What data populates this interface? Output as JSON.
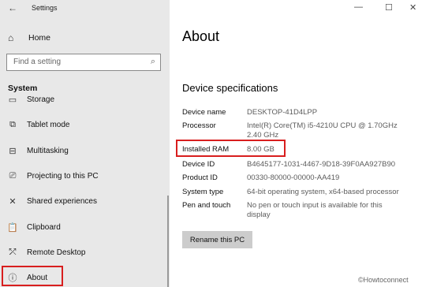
{
  "window": {
    "back_glyph": "←",
    "title": "Settings",
    "minimize_glyph": "—",
    "maximize_glyph": "☐",
    "close_glyph": "✕"
  },
  "sidebar": {
    "home_icon": "home-icon",
    "home_label": "Home",
    "search_placeholder": "Find a setting",
    "search_icon": "search-icon",
    "section_title": "System",
    "items": [
      {
        "label": "Storage",
        "icon": "storage-icon",
        "glyph": "▭"
      },
      {
        "label": "Tablet mode",
        "icon": "tablet-mode-icon",
        "glyph": "⧉"
      },
      {
        "label": "Multitasking",
        "icon": "multitasking-icon",
        "glyph": "⊟"
      },
      {
        "label": "Projecting to this PC",
        "icon": "projector-icon",
        "glyph": "⎚"
      },
      {
        "label": "Shared experiences",
        "icon": "shared-experiences-icon",
        "glyph": "✕"
      },
      {
        "label": "Clipboard",
        "icon": "clipboard-icon",
        "glyph": "📋"
      },
      {
        "label": "Remote Desktop",
        "icon": "remote-desktop-icon",
        "glyph": "⤱"
      },
      {
        "label": "About",
        "icon": "info-icon",
        "glyph": "ⓘ",
        "selected": true
      }
    ]
  },
  "main": {
    "title": "About",
    "specs_heading": "Device specifications",
    "specs": [
      {
        "label": "Device name",
        "value": "DESKTOP-41D4LPP"
      },
      {
        "label": "Processor",
        "value": "Intel(R) Core(TM) i5-4210U CPU @ 1.70GHz",
        "value2": "2.40 GHz"
      },
      {
        "label": "Installed RAM",
        "value": "8.00 GB"
      },
      {
        "label": "Device ID",
        "value": "B4645177-1031-4467-9D18-39F0AA927B90"
      },
      {
        "label": "Product ID",
        "value": "00330-80000-00000-AA419"
      },
      {
        "label": "System type",
        "value": "64-bit operating system, x64-based processor"
      },
      {
        "label": "Pen and touch",
        "value": "No pen or touch input is available for this",
        "value2": "display"
      }
    ],
    "rename_button": "Rename this PC"
  },
  "highlight_color": "#d81e1e",
  "watermark": "©Howtoconnect"
}
